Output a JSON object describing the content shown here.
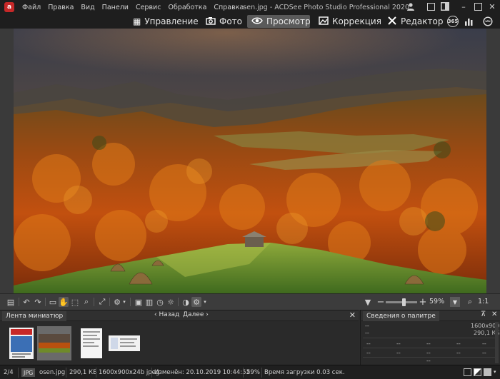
{
  "app": {
    "logo_letter": "a"
  },
  "menu": [
    "Файл",
    "Правка",
    "Вид",
    "Панели",
    "Сервис",
    "Обработка",
    "Справка"
  ],
  "title": "sen.jpg - ACDSee Photo Studio Professional 2020",
  "modes": {
    "manage": "Управление",
    "photos": "Фото",
    "view": "Просмотр",
    "develop": "Коррекция",
    "edit": "Редактор",
    "badge_365": "365"
  },
  "viewtools": {
    "zoom": "59%",
    "zoom_level": 0.59,
    "ratio": "1:1"
  },
  "thumbs": {
    "tab": "Лента миниатюр",
    "back": "Назад",
    "next": "Далее"
  },
  "palette": {
    "tab": "Сведения о палитре",
    "dash": "--",
    "dimensions": "1600x900",
    "size": "290,1 КБ"
  },
  "status": {
    "index": "2/4",
    "format": "JPG",
    "filename": "osen.jpg",
    "filesize": "290,1 КБ",
    "dims": "1600x900x24b jpeg",
    "modified": "Изменён: 20.10.2019 10:44:52",
    "zoom": "59%",
    "load_time": "Время загрузки 0.03 сек."
  },
  "colors": {
    "accent_active": "#5a5a5a",
    "background": "#2b2b2b",
    "logo_red": "#c62828"
  },
  "icons": [
    "app-logo-icon",
    "user-icon",
    "window-mode-icon",
    "split-icon",
    "minimize-icon",
    "maximize-icon",
    "close-icon",
    "grid-icon",
    "camera-icon",
    "eye-icon",
    "develop-icon",
    "edit-icon",
    "stats-icon",
    "face-icon"
  ]
}
